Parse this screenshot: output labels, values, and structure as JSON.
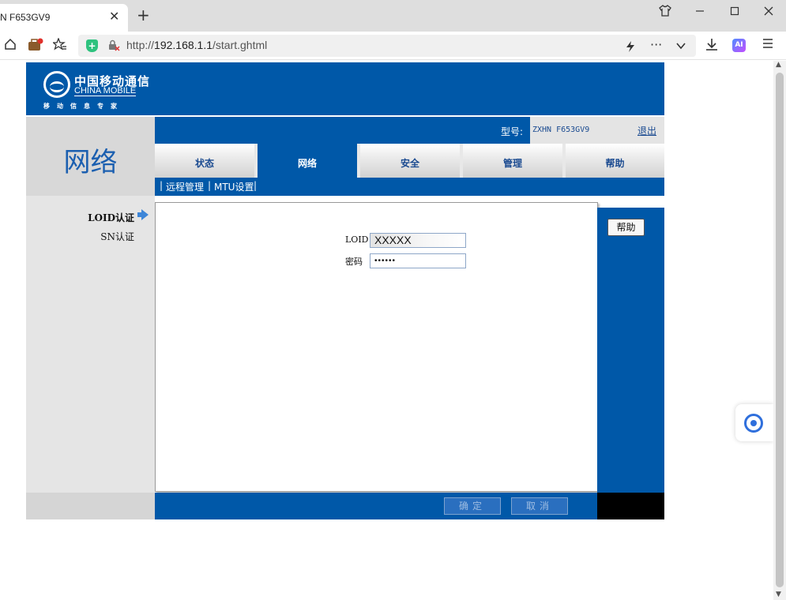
{
  "browser": {
    "tab_title": "N F653GV9",
    "close_glyph": "✕",
    "new_tab_glyph": "+",
    "url_prefix": "http://",
    "url_host": "192.168.1.1",
    "url_path": "/start.ghtml",
    "ai_label": "AI",
    "icons": [
      "home-icon",
      "briefcase-icon",
      "star-list-icon",
      "shield-icon",
      "lock-icon",
      "bolt-icon",
      "more-icon",
      "chevron-down-icon",
      "download-icon",
      "ai-icon",
      "menu-icon",
      "shirt-icon",
      "minimize-icon",
      "maximize-icon",
      "close-icon"
    ]
  },
  "router": {
    "brand_cn": "中国移动通信",
    "brand_en": "CHINA MOBILE",
    "slogan": "移动信息专家",
    "section_title": "网络",
    "model_label": "型号:",
    "model_value": "ZXHN F653GV9",
    "logout": "退出",
    "tabs": [
      {
        "label": "状态"
      },
      {
        "label": "网络"
      },
      {
        "label": "安全"
      },
      {
        "label": "管理"
      },
      {
        "label": "帮助"
      }
    ],
    "subnav": {
      "sep": "|",
      "items": [
        "远程管理",
        "MTU设置"
      ]
    },
    "menu": {
      "loid": "LOID认证",
      "sn": "SN认证"
    },
    "form": {
      "loid_label": "LOID",
      "loid_value": "XXXXX",
      "password_label": "密码",
      "password_value": "••••••"
    },
    "help_button": "帮助",
    "confirm_button": "确定",
    "cancel_button": "取消"
  },
  "colors": {
    "brand_blue": "#0058a8",
    "nav_gray": "#d8d8d8",
    "title_blue": "#1b5fb0"
  }
}
